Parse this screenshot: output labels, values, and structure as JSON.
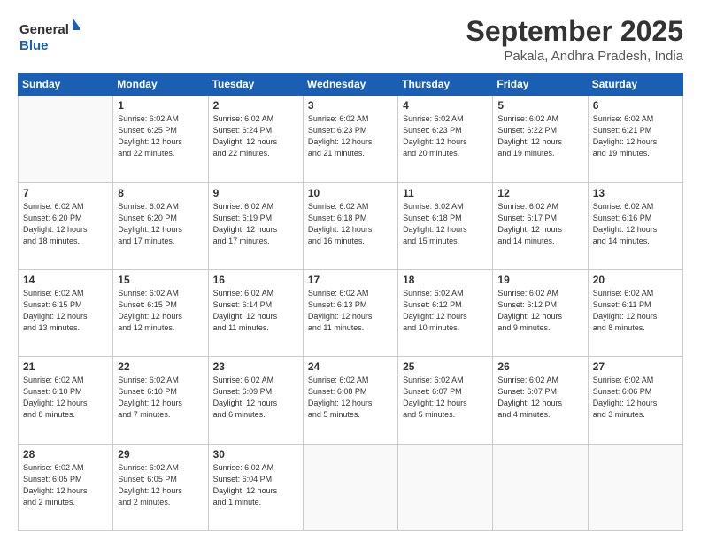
{
  "header": {
    "logo_line1": "General",
    "logo_line2": "Blue",
    "month": "September 2025",
    "location": "Pakala, Andhra Pradesh, India"
  },
  "weekdays": [
    "Sunday",
    "Monday",
    "Tuesday",
    "Wednesday",
    "Thursday",
    "Friday",
    "Saturday"
  ],
  "weeks": [
    [
      {
        "day": "",
        "info": ""
      },
      {
        "day": "1",
        "info": "Sunrise: 6:02 AM\nSunset: 6:25 PM\nDaylight: 12 hours\nand 22 minutes."
      },
      {
        "day": "2",
        "info": "Sunrise: 6:02 AM\nSunset: 6:24 PM\nDaylight: 12 hours\nand 22 minutes."
      },
      {
        "day": "3",
        "info": "Sunrise: 6:02 AM\nSunset: 6:23 PM\nDaylight: 12 hours\nand 21 minutes."
      },
      {
        "day": "4",
        "info": "Sunrise: 6:02 AM\nSunset: 6:23 PM\nDaylight: 12 hours\nand 20 minutes."
      },
      {
        "day": "5",
        "info": "Sunrise: 6:02 AM\nSunset: 6:22 PM\nDaylight: 12 hours\nand 19 minutes."
      },
      {
        "day": "6",
        "info": "Sunrise: 6:02 AM\nSunset: 6:21 PM\nDaylight: 12 hours\nand 19 minutes."
      }
    ],
    [
      {
        "day": "7",
        "info": "Sunrise: 6:02 AM\nSunset: 6:20 PM\nDaylight: 12 hours\nand 18 minutes."
      },
      {
        "day": "8",
        "info": "Sunrise: 6:02 AM\nSunset: 6:20 PM\nDaylight: 12 hours\nand 17 minutes."
      },
      {
        "day": "9",
        "info": "Sunrise: 6:02 AM\nSunset: 6:19 PM\nDaylight: 12 hours\nand 17 minutes."
      },
      {
        "day": "10",
        "info": "Sunrise: 6:02 AM\nSunset: 6:18 PM\nDaylight: 12 hours\nand 16 minutes."
      },
      {
        "day": "11",
        "info": "Sunrise: 6:02 AM\nSunset: 6:18 PM\nDaylight: 12 hours\nand 15 minutes."
      },
      {
        "day": "12",
        "info": "Sunrise: 6:02 AM\nSunset: 6:17 PM\nDaylight: 12 hours\nand 14 minutes."
      },
      {
        "day": "13",
        "info": "Sunrise: 6:02 AM\nSunset: 6:16 PM\nDaylight: 12 hours\nand 14 minutes."
      }
    ],
    [
      {
        "day": "14",
        "info": "Sunrise: 6:02 AM\nSunset: 6:15 PM\nDaylight: 12 hours\nand 13 minutes."
      },
      {
        "day": "15",
        "info": "Sunrise: 6:02 AM\nSunset: 6:15 PM\nDaylight: 12 hours\nand 12 minutes."
      },
      {
        "day": "16",
        "info": "Sunrise: 6:02 AM\nSunset: 6:14 PM\nDaylight: 12 hours\nand 11 minutes."
      },
      {
        "day": "17",
        "info": "Sunrise: 6:02 AM\nSunset: 6:13 PM\nDaylight: 12 hours\nand 11 minutes."
      },
      {
        "day": "18",
        "info": "Sunrise: 6:02 AM\nSunset: 6:12 PM\nDaylight: 12 hours\nand 10 minutes."
      },
      {
        "day": "19",
        "info": "Sunrise: 6:02 AM\nSunset: 6:12 PM\nDaylight: 12 hours\nand 9 minutes."
      },
      {
        "day": "20",
        "info": "Sunrise: 6:02 AM\nSunset: 6:11 PM\nDaylight: 12 hours\nand 8 minutes."
      }
    ],
    [
      {
        "day": "21",
        "info": "Sunrise: 6:02 AM\nSunset: 6:10 PM\nDaylight: 12 hours\nand 8 minutes."
      },
      {
        "day": "22",
        "info": "Sunrise: 6:02 AM\nSunset: 6:10 PM\nDaylight: 12 hours\nand 7 minutes."
      },
      {
        "day": "23",
        "info": "Sunrise: 6:02 AM\nSunset: 6:09 PM\nDaylight: 12 hours\nand 6 minutes."
      },
      {
        "day": "24",
        "info": "Sunrise: 6:02 AM\nSunset: 6:08 PM\nDaylight: 12 hours\nand 5 minutes."
      },
      {
        "day": "25",
        "info": "Sunrise: 6:02 AM\nSunset: 6:07 PM\nDaylight: 12 hours\nand 5 minutes."
      },
      {
        "day": "26",
        "info": "Sunrise: 6:02 AM\nSunset: 6:07 PM\nDaylight: 12 hours\nand 4 minutes."
      },
      {
        "day": "27",
        "info": "Sunrise: 6:02 AM\nSunset: 6:06 PM\nDaylight: 12 hours\nand 3 minutes."
      }
    ],
    [
      {
        "day": "28",
        "info": "Sunrise: 6:02 AM\nSunset: 6:05 PM\nDaylight: 12 hours\nand 2 minutes."
      },
      {
        "day": "29",
        "info": "Sunrise: 6:02 AM\nSunset: 6:05 PM\nDaylight: 12 hours\nand 2 minutes."
      },
      {
        "day": "30",
        "info": "Sunrise: 6:02 AM\nSunset: 6:04 PM\nDaylight: 12 hours\nand 1 minute."
      },
      {
        "day": "",
        "info": ""
      },
      {
        "day": "",
        "info": ""
      },
      {
        "day": "",
        "info": ""
      },
      {
        "day": "",
        "info": ""
      }
    ]
  ]
}
